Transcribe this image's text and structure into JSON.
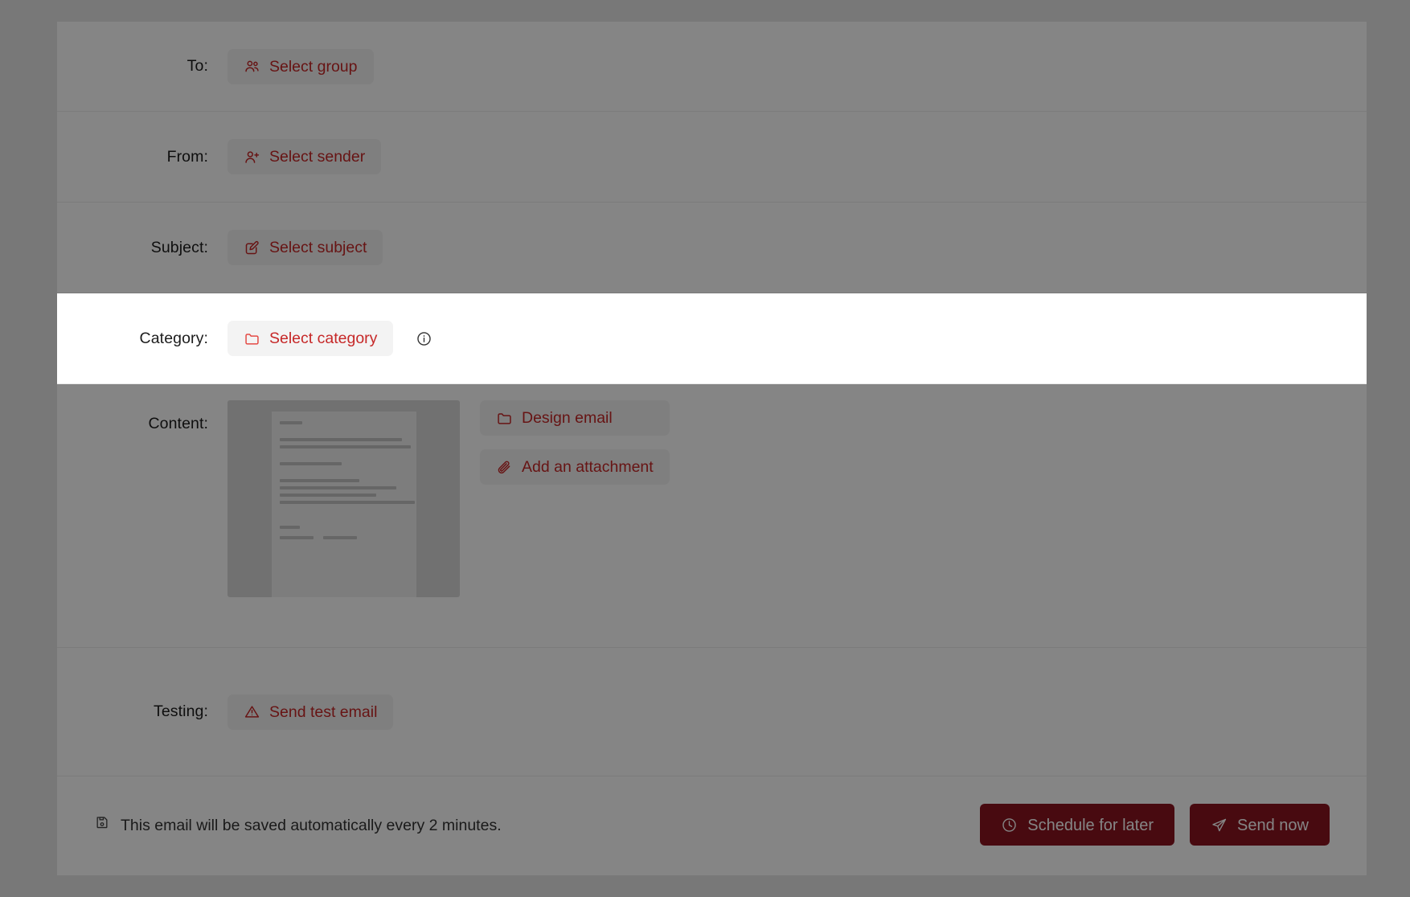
{
  "rows": {
    "to": {
      "label": "To:",
      "button": {
        "text": "Select group",
        "icon": "users-icon"
      }
    },
    "from": {
      "label": "From:",
      "button": {
        "text": "Select sender",
        "icon": "user-plus-icon"
      }
    },
    "subject": {
      "label": "Subject:",
      "button": {
        "text": "Select subject",
        "icon": "pencil-square-icon"
      }
    },
    "category": {
      "label": "Category:",
      "button": {
        "text": "Select category",
        "icon": "folder-icon"
      },
      "info": {
        "icon": "info-circle-icon"
      }
    },
    "content": {
      "label": "Content:",
      "preview": {
        "name": "email-preview-thumbnail"
      },
      "design_button": {
        "text": "Design email",
        "icon": "folder-icon"
      },
      "attachment_button": {
        "text": "Add an attachment",
        "icon": "paperclip-icon"
      }
    },
    "testing": {
      "label": "Testing:",
      "button": {
        "text": "Send test email",
        "icon": "warning-triangle-icon"
      }
    }
  },
  "footer": {
    "autosave_icon": "save-disk-icon",
    "autosave_text": "This email will be saved automatically every 2 minutes.",
    "schedule_button": {
      "text": "Schedule for later",
      "icon": "clock-icon"
    },
    "send_button": {
      "text": "Send now",
      "icon": "paper-plane-icon"
    }
  },
  "colors": {
    "accent_red": "#c62828",
    "primary_button": "#8a1420",
    "ghost_button_bg": "#f3f3f3",
    "label_text": "#1c1c1c",
    "divider": "#ebebeb",
    "overlay": "rgba(0,0,0,0.5)"
  },
  "highlight": {
    "target": "category-row",
    "description": "Category row is spotlighted; the rest of the page is dimmed by an overlay."
  }
}
